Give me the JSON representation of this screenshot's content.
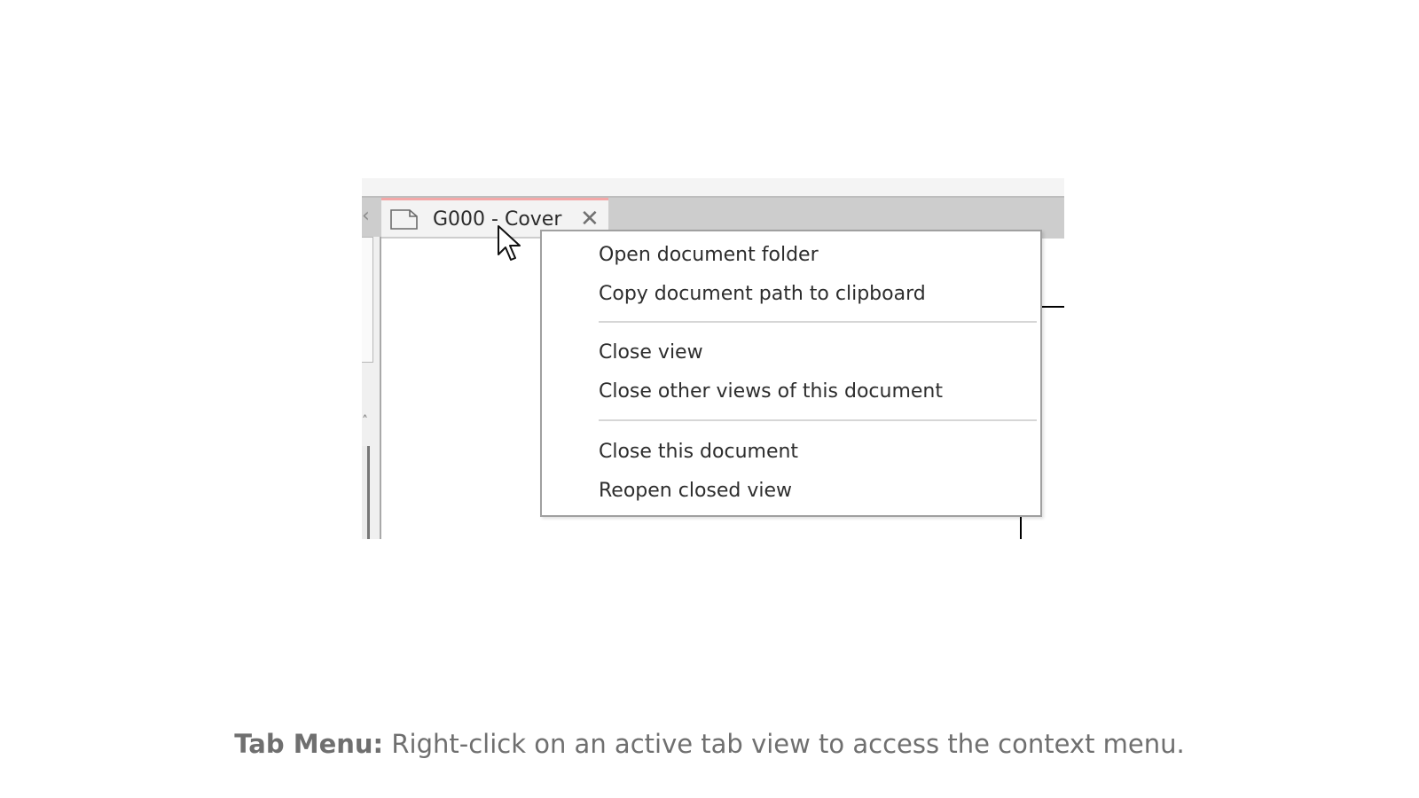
{
  "tab": {
    "title": "G000 - Cover",
    "doc_icon": "document-icon",
    "close_icon": "close-icon",
    "scroll_left_icon": "chevron-left-icon"
  },
  "context_menu": {
    "items": [
      "Open document folder",
      "Copy document path to clipboard",
      "Close view",
      "Close other views of this document",
      "Close this document",
      "Reopen closed view"
    ]
  },
  "caption": {
    "lead": "Tab Menu:",
    "text": " Right-click on an active tab view to access the context menu."
  },
  "colors": {
    "tab_accent": "#f3a7a7",
    "tabbar_background": "#cdcdcd",
    "menu_border": "#a0a0a0",
    "caption_text": "#6f6f6f"
  }
}
